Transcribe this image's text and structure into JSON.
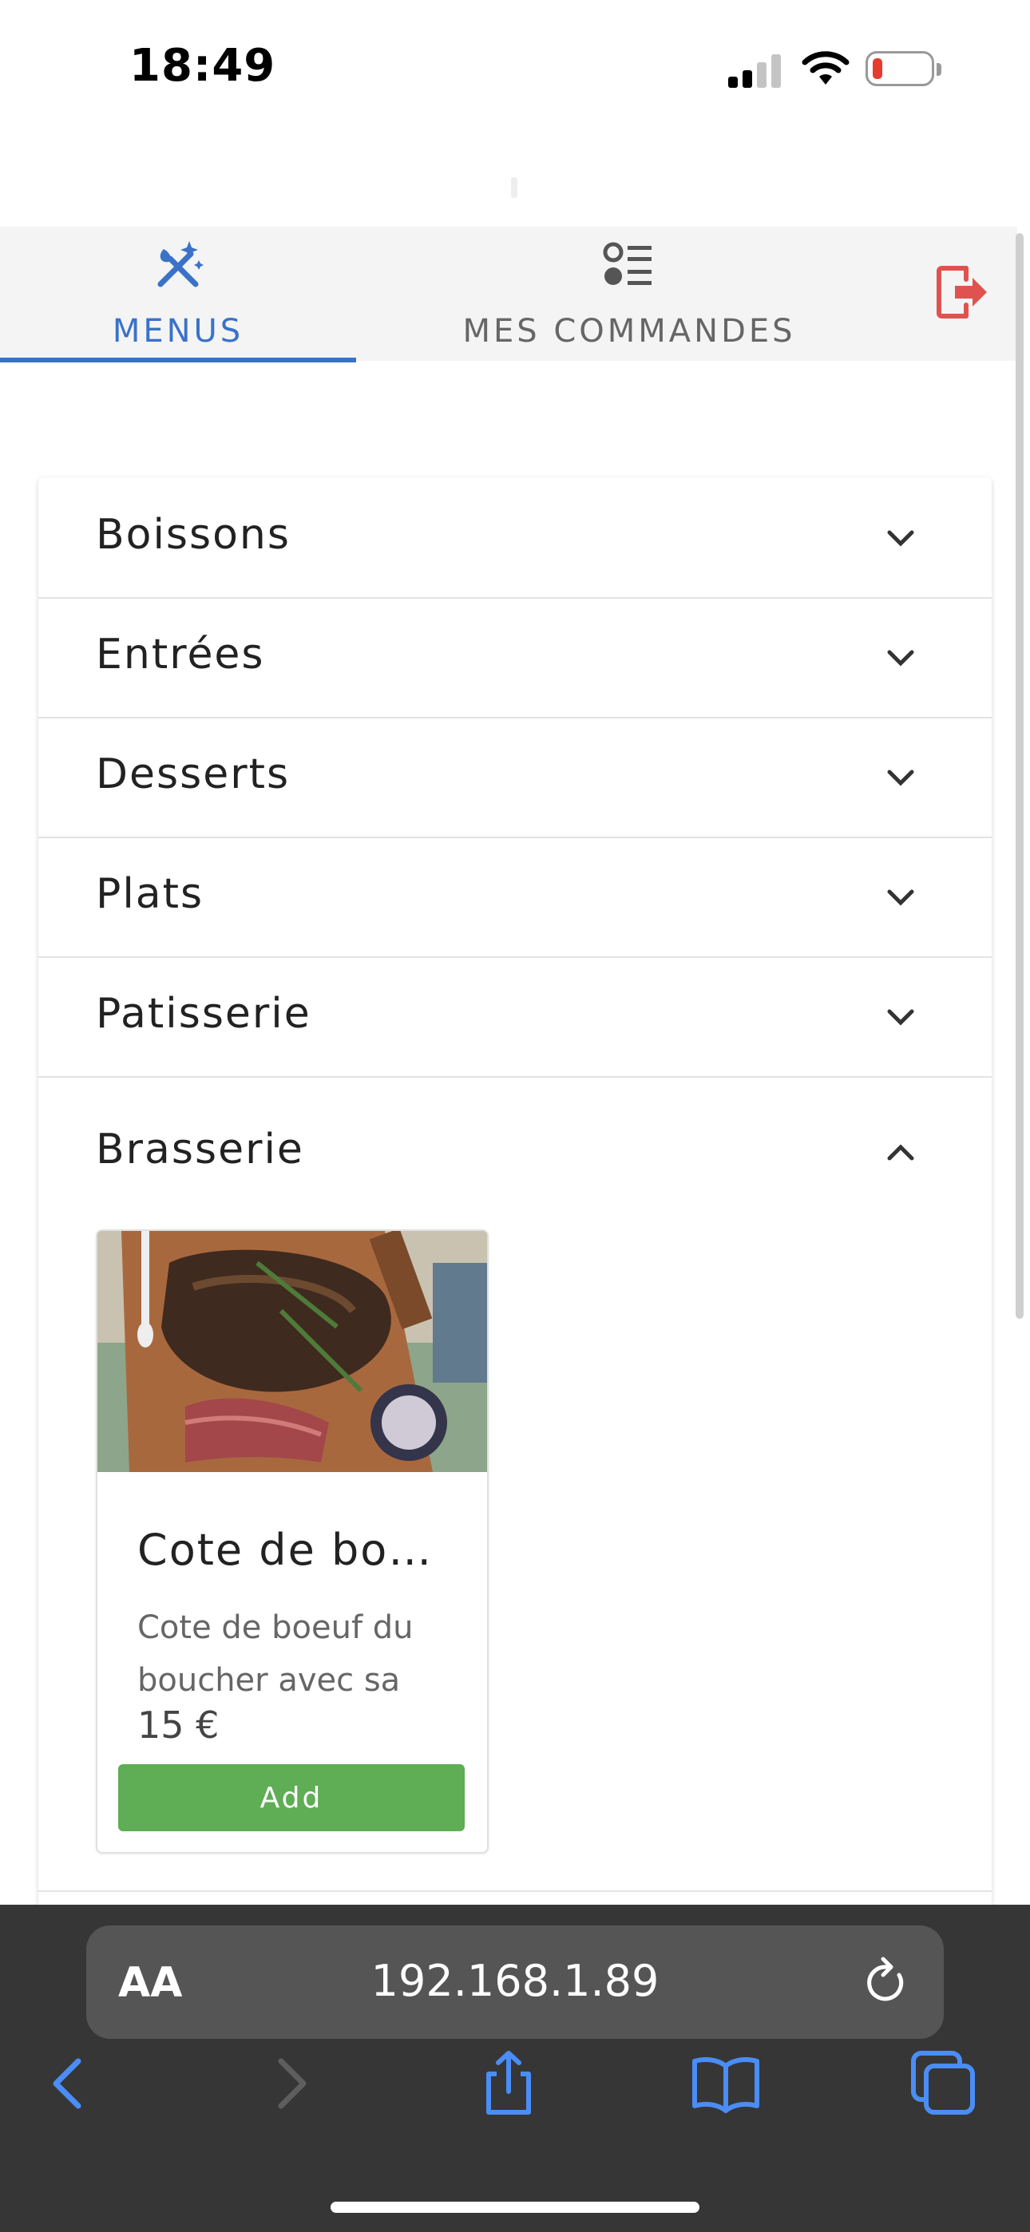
{
  "status_bar": {
    "time": "18:49"
  },
  "tabs": [
    {
      "label": "MENUS",
      "icon": "fork-knife-sparkle-icon",
      "active": true
    },
    {
      "label": "MES COMMANDES",
      "icon": "list-icon",
      "active": false
    }
  ],
  "logout_icon": "logout-icon",
  "accordion": {
    "sections": [
      {
        "title": "Boissons",
        "expanded": false
      },
      {
        "title": "Entrées",
        "expanded": false
      },
      {
        "title": "Desserts",
        "expanded": false
      },
      {
        "title": "Plats",
        "expanded": false
      },
      {
        "title": "Patisserie",
        "expanded": false
      },
      {
        "title": "Brasserie",
        "expanded": true
      }
    ]
  },
  "product": {
    "name": "Cote de boeuf",
    "description": "Cote de boeuf du boucher avec sa",
    "price": "15 €",
    "add_label": "Add"
  },
  "browser": {
    "text_size_label": "AA",
    "url": "192.168.1.89"
  },
  "colors": {
    "accent": "#3a72c8",
    "add_button": "#5fad55",
    "logout": "#e0524f",
    "browser_bar": "#363636",
    "browser_buttons": "#4a8df6"
  }
}
